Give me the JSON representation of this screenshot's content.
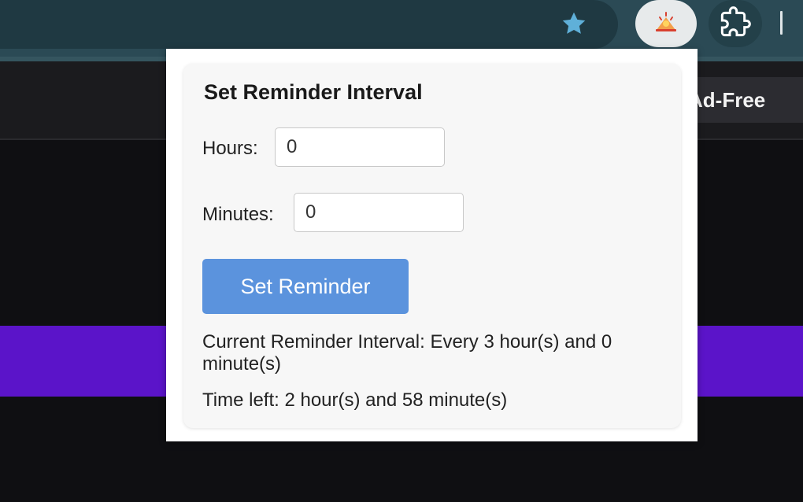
{
  "browser": {
    "icons": {
      "bookmark": "star-icon",
      "extension": "reminder-extension-icon",
      "extensions_menu": "puzzle-icon"
    },
    "colors": {
      "toolbar": "#2b4a55",
      "star": "#5fb0d9"
    }
  },
  "page": {
    "ad_free_label": "Ad-Free",
    "banner_color": "#5b14c9"
  },
  "popup": {
    "title": "Set Reminder Interval",
    "hours_label": "Hours:",
    "hours_value": "0",
    "minutes_label": "Minutes:",
    "minutes_value": "0",
    "set_button_label": "Set Reminder",
    "current_interval_text": "Current Reminder Interval: Every 3 hour(s) and 0 minute(s)",
    "time_left_text": "Time left: 2 hour(s) and 58 minute(s)",
    "button_color": "#5b93dd"
  }
}
